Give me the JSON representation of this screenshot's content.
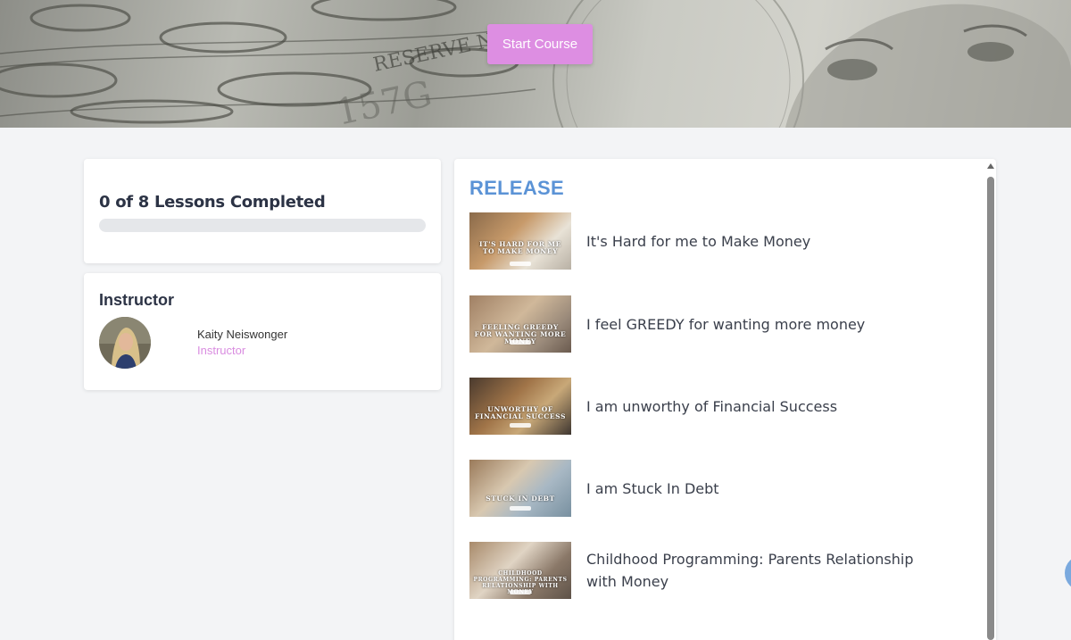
{
  "hero": {
    "start_label": "Start Course"
  },
  "progress": {
    "title": "0 of 8 Lessons Completed",
    "completed": 0,
    "total": 8
  },
  "instructor": {
    "heading": "Instructor",
    "name": "Kaity Neiswonger",
    "role": "Instructor"
  },
  "lessons_section": {
    "title": "RELEASE",
    "lessons": [
      {
        "title": "It's Hard for me to Make Money",
        "thumb_text": "IT'S HARD FOR ME TO MAKE MONEY"
      },
      {
        "title": "I feel GREEDY for wanting more money",
        "thumb_text": "FEELING GREEDY FOR WANTING MORE MONEY"
      },
      {
        "title": "I am unworthy of Financial Success",
        "thumb_text": "UNWORTHY OF FINANCIAL SUCCESS"
      },
      {
        "title": "I am Stuck In Debt",
        "thumb_text": "STUCK IN DEBT"
      },
      {
        "title": "Childhood Programming: Parents Relationship with Money",
        "thumb_text": "CHILDHOOD PROGRAMMING: PARENTS RELATIONSHIP WITH MONEY"
      }
    ]
  },
  "colors": {
    "accent": "#dd8ee2",
    "section_title": "#5b93d6",
    "background": "#f3f4f6"
  }
}
